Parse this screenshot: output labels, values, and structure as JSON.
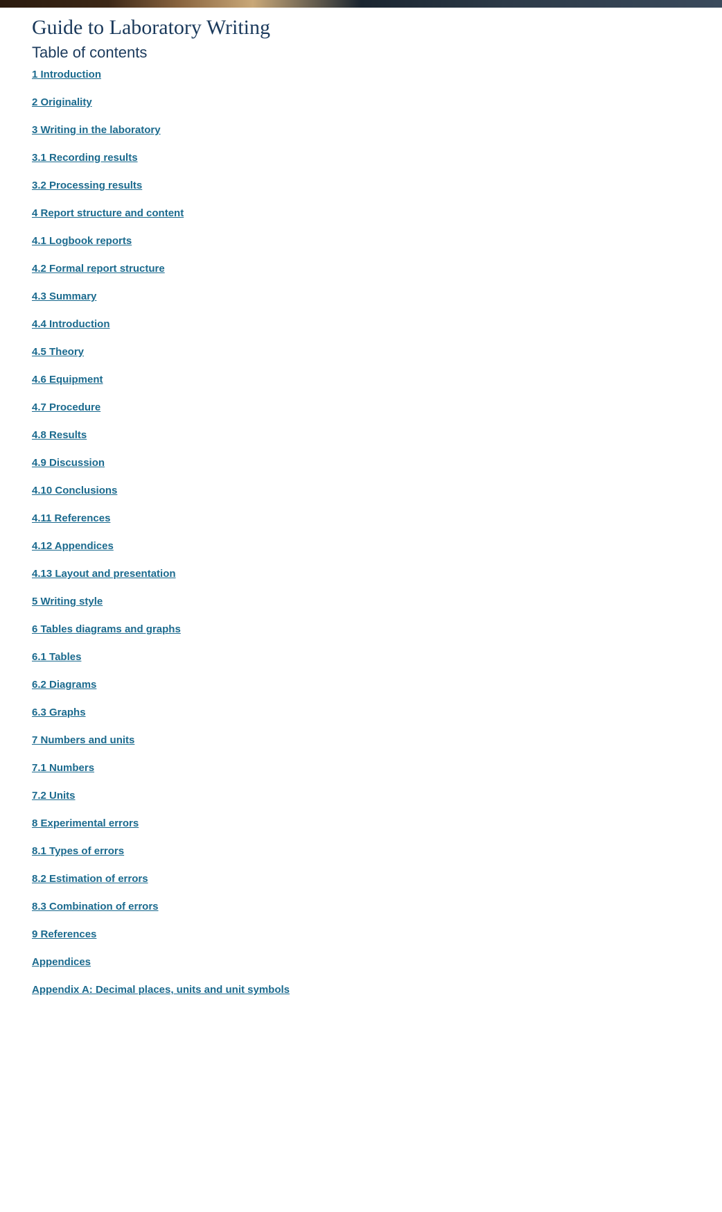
{
  "page_title": "Guide to Laboratory Writing",
  "toc_heading": "Table of contents",
  "toc_items": [
    "1 Introduction",
    "2 Originality",
    "3 Writing in the laboratory",
    "3.1 Recording results",
    "3.2 Processing results",
    "4 Report structure and content",
    "4.1 Logbook reports",
    "4.2 Formal report structure",
    "4.3 Summary",
    "4.4 Introduction",
    "4.5 Theory",
    "4.6 Equipment",
    "4.7 Procedure",
    "4.8 Results",
    "4.9 Discussion",
    "4.10 Conclusions",
    "4.11 References",
    "4.12 Appendices",
    "4.13 Layout and presentation",
    "5 Writing style",
    "6 Tables diagrams and graphs",
    "6.1 Tables",
    "6.2 Diagrams",
    "6.3 Graphs",
    "7 Numbers and units",
    "7.1 Numbers",
    "7.2 Units",
    "8 Experimental errors",
    "8.1 Types of errors",
    "8.2 Estimation of errors",
    "8.3 Combination of errors",
    "9 References",
    "Appendices",
    "Appendix A: Decimal places, units and unit symbols"
  ]
}
